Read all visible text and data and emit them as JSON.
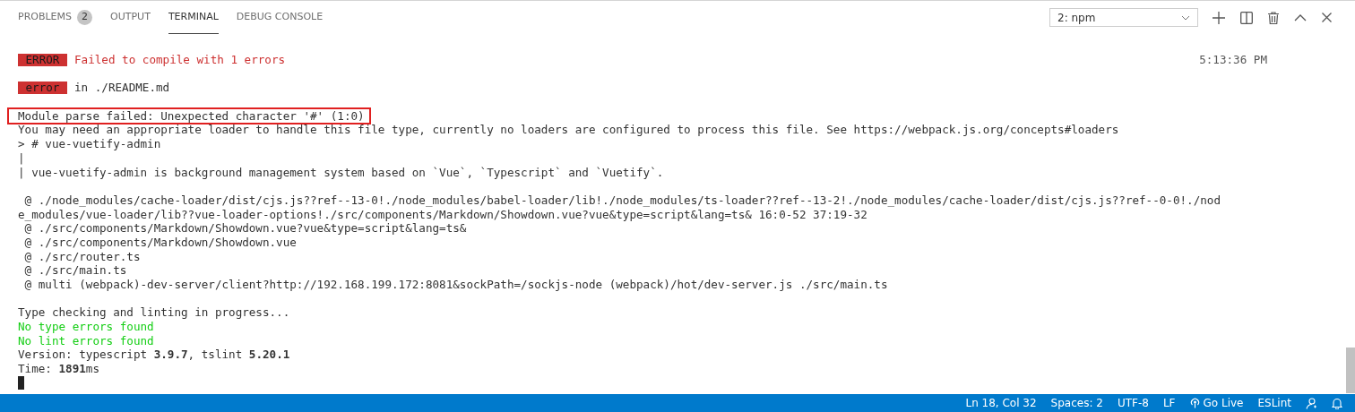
{
  "panel_tabs": [
    {
      "label": "PROBLEMS",
      "count": "2",
      "selected": false
    },
    {
      "label": "OUTPUT",
      "selected": false
    },
    {
      "label": "TERMINAL",
      "selected": true
    },
    {
      "label": "DEBUG CONSOLE",
      "selected": false
    }
  ],
  "terminal_selector": {
    "value": "2: npm"
  },
  "terminal": {
    "lines": [
      {
        "kind": "badge",
        "badge": "ERROR",
        "text": "Failed to compile with 1 errors",
        "color": "#cd3131",
        "time": "5:13:36 PM"
      },
      {
        "kind": "blank"
      },
      {
        "kind": "badge",
        "badge": "error",
        "text": "in ./README.md",
        "color": "#333333"
      },
      {
        "kind": "blank"
      },
      {
        "kind": "text",
        "text": "Module parse failed: Unexpected character '#' (1:0)",
        "color": "#333333",
        "boxed": true
      },
      {
        "kind": "text",
        "text": "You may need an appropriate loader to handle this file type, currently no loaders are configured to process this file. See https://webpack.js.org/concepts#loaders",
        "color": "#333333",
        "boxed": false
      },
      {
        "kind": "text",
        "text": "> # vue-vuetify-admin",
        "color": "#333333",
        "boxed": false
      },
      {
        "kind": "text",
        "text": "|",
        "boxed": false
      },
      {
        "kind": "text",
        "text": "| vue-vuetify-admin is background management system based on `Vue`, `Typescript` and `Vuetify`.",
        "color": "#333333",
        "boxed": false
      },
      {
        "kind": "blank"
      },
      {
        "kind": "text",
        "text": " @ ./node_modules/cache-loader/dist/cjs.js??ref--13-0!./node_modules/babel-loader/lib!./node_modules/ts-loader??ref--13-2!./node_modules/cache-loader/dist/cjs.js??ref--0-0!./nod",
        "color": "#333333",
        "boxed": false
      },
      {
        "kind": "text",
        "text": "e_modules/vue-loader/lib??vue-loader-options!./src/components/Markdown/Showdown.vue?vue&type=script&lang=ts& 16:0-52 37:19-32",
        "color": "#333333",
        "boxed": false
      },
      {
        "kind": "text",
        "text": " @ ./src/components/Markdown/Showdown.vue?vue&type=script&lang=ts&",
        "color": "#333333",
        "boxed": false
      },
      {
        "kind": "text",
        "text": " @ ./src/components/Markdown/Showdown.vue",
        "color": "#333333",
        "boxed": false
      },
      {
        "kind": "text",
        "text": " @ ./src/router.ts",
        "color": "#333333",
        "boxed": false
      },
      {
        "kind": "text",
        "text": " @ ./src/main.ts",
        "color": "#333333",
        "boxed": false
      },
      {
        "kind": "text",
        "text": " @ multi (webpack)-dev-server/client?http://192.168.199.172:8081&sockPath=/sockjs-node (webpack)/hot/dev-server.js ./src/main.ts",
        "color": "#333333",
        "boxed": false
      },
      {
        "kind": "blank"
      },
      {
        "kind": "text",
        "text": "Type checking and linting in progress...",
        "color": "#333333",
        "boxed": false
      },
      {
        "kind": "text",
        "text": "No type errors found",
        "color": "#14ce14",
        "boxed": false
      },
      {
        "kind": "text",
        "text": "No lint errors found",
        "color": "#14ce14",
        "boxed": false
      },
      {
        "kind": "text",
        "text": "Version: typescript **3.9.7**, tslint **5.20.1**",
        "color": "#333333",
        "boxed": false
      },
      {
        "kind": "text",
        "text": "Time: **1891**ms",
        "color": "#333333",
        "boxed": false
      },
      {
        "kind": "cursor"
      }
    ]
  },
  "status_bar": {
    "items": [
      {
        "kind": "text",
        "label": "Ln 18, Col 32"
      },
      {
        "kind": "text",
        "label": "Spaces: 2"
      },
      {
        "kind": "text",
        "label": "UTF-8"
      },
      {
        "kind": "text",
        "label": "LF"
      },
      {
        "kind": "live",
        "label": "Go Live"
      },
      {
        "kind": "text",
        "label": "ESLint"
      },
      {
        "kind": "feedback"
      },
      {
        "kind": "bell"
      }
    ]
  }
}
